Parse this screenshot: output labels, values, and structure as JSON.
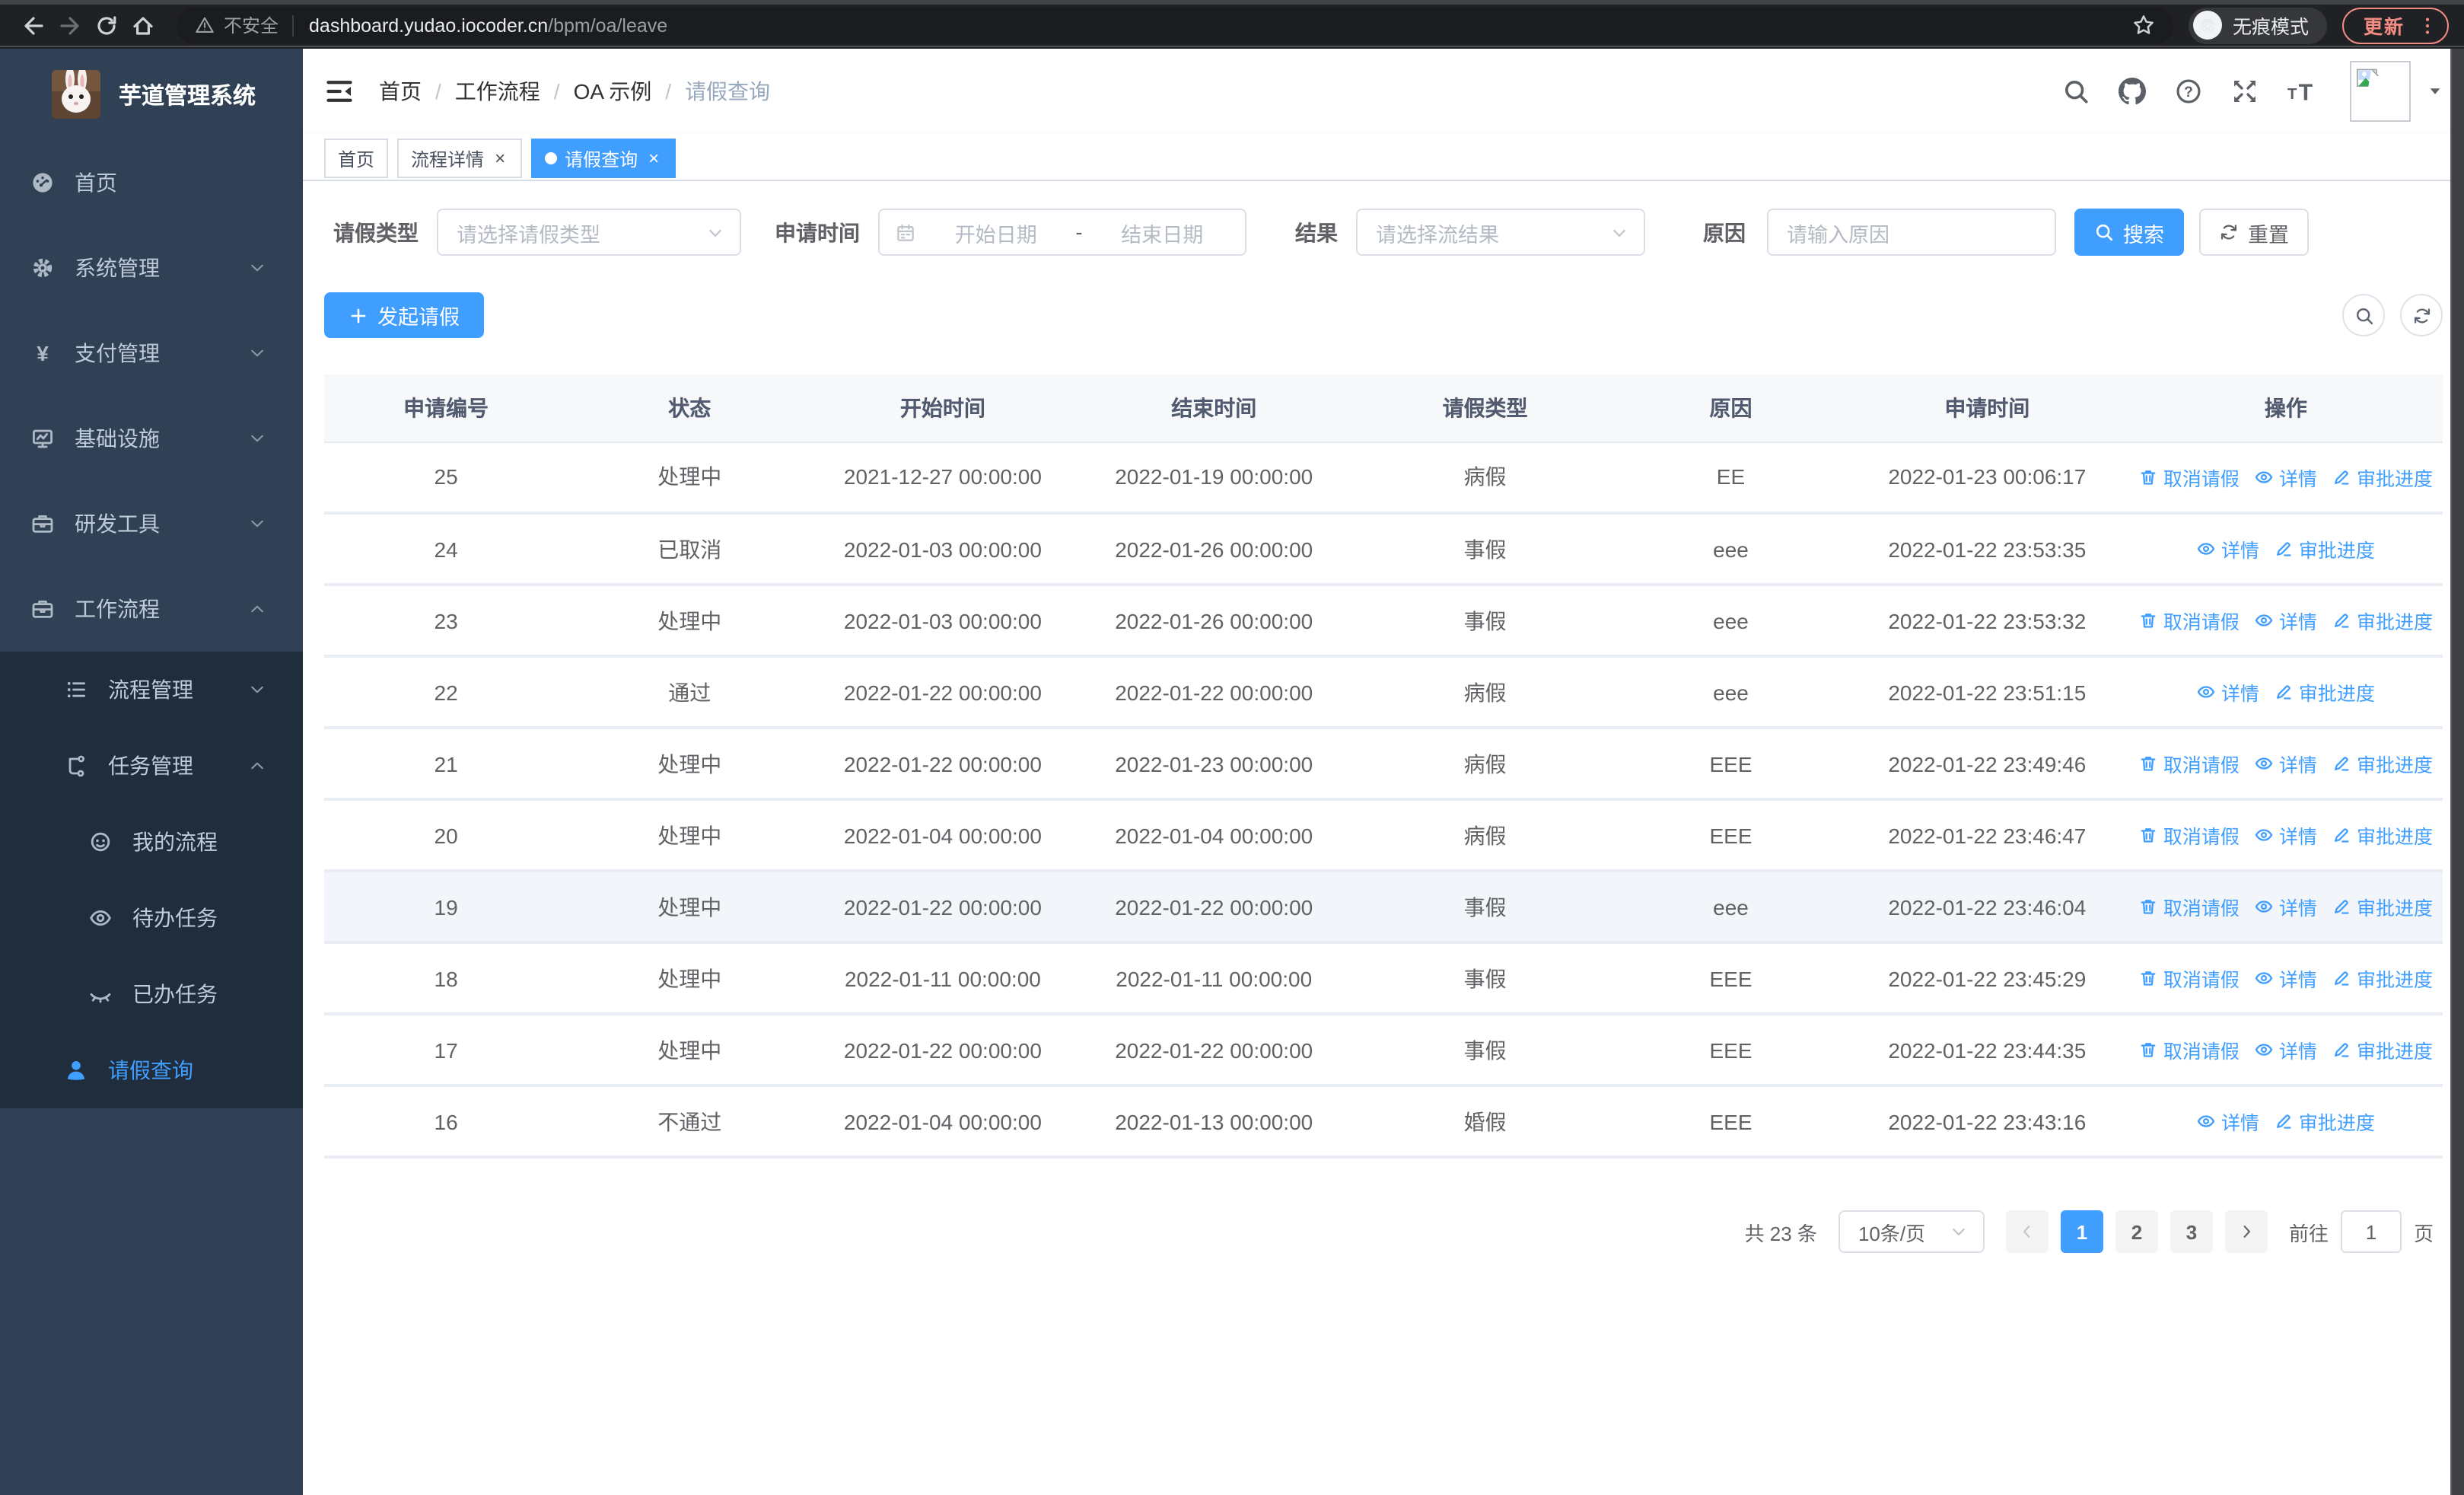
{
  "browser": {
    "security_label": "不安全",
    "url_host": "dashboard.yudao.iocoder.cn",
    "url_path": "/bpm/oa/leave",
    "incognito_label": "无痕模式",
    "update_label": "更新"
  },
  "sidebar": {
    "title": "芋道管理系统",
    "items": [
      {
        "label": "首页",
        "icon": "dashboard",
        "level": 1,
        "sub": false,
        "chevron": null,
        "active": false
      },
      {
        "label": "系统管理",
        "icon": "gear",
        "level": 1,
        "sub": false,
        "chevron": "down",
        "active": false
      },
      {
        "label": "支付管理",
        "icon": "yen",
        "level": 1,
        "sub": false,
        "chevron": "down",
        "active": false
      },
      {
        "label": "基础设施",
        "icon": "monitor",
        "level": 1,
        "sub": false,
        "chevron": "down",
        "active": false
      },
      {
        "label": "研发工具",
        "icon": "briefcase",
        "level": 1,
        "sub": false,
        "chevron": "down",
        "active": false
      },
      {
        "label": "工作流程",
        "icon": "briefcase",
        "level": 1,
        "sub": false,
        "chevron": "up",
        "active": false
      },
      {
        "label": "流程管理",
        "icon": "list",
        "level": 2,
        "sub": true,
        "chevron": "down",
        "active": false
      },
      {
        "label": "任务管理",
        "icon": "flow",
        "level": 2,
        "sub": true,
        "chevron": "up",
        "active": false
      },
      {
        "label": "我的流程",
        "icon": "face",
        "level": 3,
        "sub": true,
        "chevron": null,
        "active": false
      },
      {
        "label": "待办任务",
        "icon": "eye",
        "level": 3,
        "sub": true,
        "chevron": null,
        "active": false
      },
      {
        "label": "已办任务",
        "icon": "eyeclosed",
        "level": 3,
        "sub": true,
        "chevron": null,
        "active": false
      },
      {
        "label": "请假查询",
        "icon": "user",
        "level": 2,
        "sub": true,
        "chevron": null,
        "active": true
      }
    ]
  },
  "header": {
    "breadcrumb": [
      "首页",
      "工作流程",
      "OA 示例",
      "请假查询"
    ]
  },
  "tabs": [
    {
      "label": "首页",
      "closable": false,
      "active": false
    },
    {
      "label": "流程详情",
      "closable": true,
      "active": false
    },
    {
      "label": "请假查询",
      "closable": true,
      "active": true
    }
  ],
  "filters": {
    "leave_type": {
      "label": "请假类型",
      "placeholder": "请选择请假类型"
    },
    "apply_time": {
      "label": "申请时间",
      "start_placeholder": "开始日期",
      "separator": "-",
      "end_placeholder": "结束日期"
    },
    "result": {
      "label": "结果",
      "placeholder": "请选择流结果"
    },
    "reason": {
      "label": "原因",
      "placeholder": "请输入原因"
    },
    "search_label": "搜索",
    "reset_label": "重置"
  },
  "toolbar": {
    "create_label": "发起请假"
  },
  "table": {
    "columns": [
      "申请编号",
      "状态",
      "开始时间",
      "结束时间",
      "请假类型",
      "原因",
      "申请时间",
      "操作"
    ],
    "action_defs": {
      "cancel": {
        "label": "取消请假",
        "icon": "trash"
      },
      "detail": {
        "label": "详情",
        "icon": "view"
      },
      "progress": {
        "label": "审批进度",
        "icon": "edit"
      }
    },
    "rows": [
      {
        "id": "25",
        "status": "处理中",
        "start": "2021-12-27 00:00:00",
        "end": "2022-01-19 00:00:00",
        "type": "病假",
        "reason": "EE",
        "apply_time": "2022-01-23 00:06:17",
        "actions": [
          "cancel",
          "detail",
          "progress"
        ],
        "highlight": false
      },
      {
        "id": "24",
        "status": "已取消",
        "start": "2022-01-03 00:00:00",
        "end": "2022-01-26 00:00:00",
        "type": "事假",
        "reason": "eee",
        "apply_time": "2022-01-22 23:53:35",
        "actions": [
          "detail",
          "progress"
        ],
        "highlight": false
      },
      {
        "id": "23",
        "status": "处理中",
        "start": "2022-01-03 00:00:00",
        "end": "2022-01-26 00:00:00",
        "type": "事假",
        "reason": "eee",
        "apply_time": "2022-01-22 23:53:32",
        "actions": [
          "cancel",
          "detail",
          "progress"
        ],
        "highlight": false
      },
      {
        "id": "22",
        "status": "通过",
        "start": "2022-01-22 00:00:00",
        "end": "2022-01-22 00:00:00",
        "type": "病假",
        "reason": "eee",
        "apply_time": "2022-01-22 23:51:15",
        "actions": [
          "detail",
          "progress"
        ],
        "highlight": false
      },
      {
        "id": "21",
        "status": "处理中",
        "start": "2022-01-22 00:00:00",
        "end": "2022-01-23 00:00:00",
        "type": "病假",
        "reason": "EEE",
        "apply_time": "2022-01-22 23:49:46",
        "actions": [
          "cancel",
          "detail",
          "progress"
        ],
        "highlight": false
      },
      {
        "id": "20",
        "status": "处理中",
        "start": "2022-01-04 00:00:00",
        "end": "2022-01-04 00:00:00",
        "type": "病假",
        "reason": "EEE",
        "apply_time": "2022-01-22 23:46:47",
        "actions": [
          "cancel",
          "detail",
          "progress"
        ],
        "highlight": false
      },
      {
        "id": "19",
        "status": "处理中",
        "start": "2022-01-22 00:00:00",
        "end": "2022-01-22 00:00:00",
        "type": "事假",
        "reason": "eee",
        "apply_time": "2022-01-22 23:46:04",
        "actions": [
          "cancel",
          "detail",
          "progress"
        ],
        "highlight": true
      },
      {
        "id": "18",
        "status": "处理中",
        "start": "2022-01-11 00:00:00",
        "end": "2022-01-11 00:00:00",
        "type": "事假",
        "reason": "EEE",
        "apply_time": "2022-01-22 23:45:29",
        "actions": [
          "cancel",
          "detail",
          "progress"
        ],
        "highlight": false
      },
      {
        "id": "17",
        "status": "处理中",
        "start": "2022-01-22 00:00:00",
        "end": "2022-01-22 00:00:00",
        "type": "事假",
        "reason": "EEE",
        "apply_time": "2022-01-22 23:44:35",
        "actions": [
          "cancel",
          "detail",
          "progress"
        ],
        "highlight": false
      },
      {
        "id": "16",
        "status": "不通过",
        "start": "2022-01-04 00:00:00",
        "end": "2022-01-13 00:00:00",
        "type": "婚假",
        "reason": "EEE",
        "apply_time": "2022-01-22 23:43:16",
        "actions": [
          "detail",
          "progress"
        ],
        "highlight": false
      }
    ]
  },
  "pagination": {
    "total_label": "共 23 条",
    "page_size": "10条/页",
    "pages": [
      "1",
      "2",
      "3"
    ],
    "active_page": "1",
    "goto_label": "前往",
    "goto_value": "1",
    "page_unit": "页"
  },
  "colors": {
    "accent": "#409eff",
    "sidebar_bg": "#304156",
    "submenu_bg": "#1f2d3d",
    "sidebar_text": "#bfcbd9",
    "breadcrumb_muted": "#97a8be",
    "browser_bar_bg": "#202124",
    "update_coral": "#f28b82",
    "table_header_bg": "#f7f8fa",
    "row_highlight": "#f2f5fa"
  }
}
